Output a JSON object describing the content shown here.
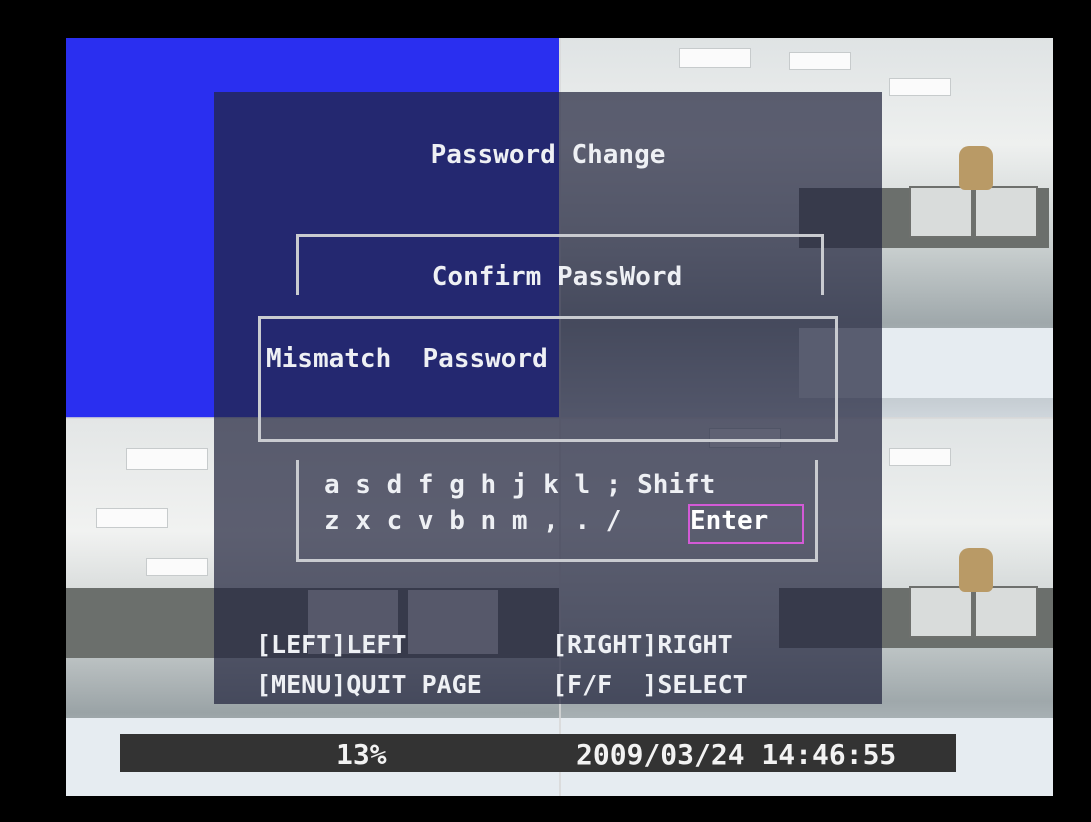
{
  "dialog": {
    "title": "Password Change",
    "confirm_label": "Confirm PassWord",
    "message": "Mismatch  Password"
  },
  "keyboard": {
    "row1": "a s d f g h j k l ; Shift",
    "row2": "z x c v b n m , . /",
    "enter_label": "Enter"
  },
  "help": {
    "left": "[LEFT]LEFT",
    "quit": "[MENU]QUIT PAGE",
    "right": "[RIGHT]RIGHT",
    "select": "[F/F  ]SELECT"
  },
  "status_bar": {
    "percent": "13%",
    "datetime": "2009/03/24 14:46:55"
  },
  "colors": {
    "blue_channel": "#2a2ff0",
    "selection_border": "#d35ad6"
  }
}
